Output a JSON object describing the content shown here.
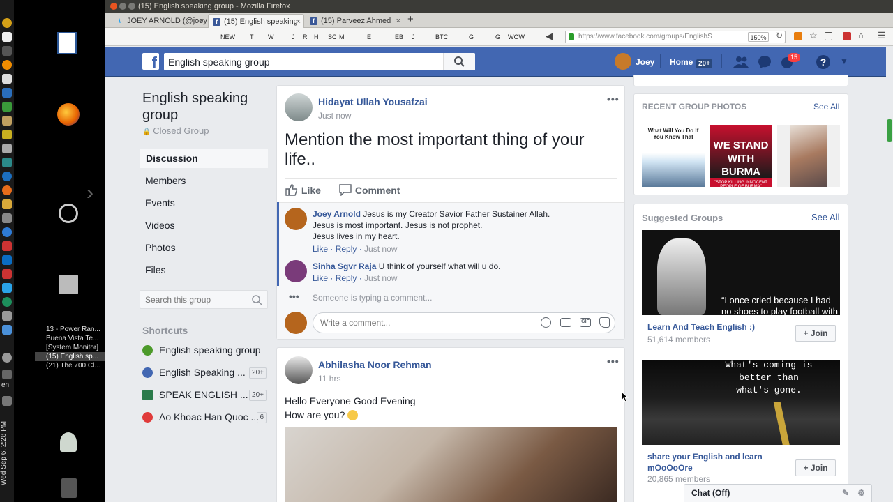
{
  "window": {
    "title": "(15) English speaking group - Mozilla Firefox",
    "tabs": [
      {
        "label": "JOEY ARNOLD (@joey"
      },
      {
        "label": "(15) English speaking"
      },
      {
        "label": "(15) Parveez Ahmed"
      }
    ],
    "new_tab": "+",
    "bookmarks": [
      "NEW",
      "T",
      "W",
      "J",
      "R",
      "H",
      "SC",
      "M",
      "E",
      "EB",
      "J",
      "BTC",
      "G",
      "G",
      "WOW"
    ],
    "url": "https://www.facebook.com/groups/EnglishS",
    "zoom": "150%"
  },
  "desktop": {
    "taskbar_items": [
      "13 - Power Ran...",
      "Buena Vista Te...",
      "[System Monitor]",
      "(15) English sp...",
      "(21) The 700 Cl..."
    ],
    "keyboard": "en",
    "clock": "Wed Sep 6, 2:28 PM"
  },
  "fbheader": {
    "logo": "f",
    "search_value": "English speaking group",
    "user": "Joey",
    "home": "Home",
    "home_count": "20+",
    "notif_count": "15"
  },
  "group": {
    "name": "English speaking group",
    "privacy": "Closed Group",
    "nav": [
      "Discussion",
      "Members",
      "Events",
      "Videos",
      "Photos",
      "Files"
    ],
    "search_placeholder": "Search this group",
    "shortcuts_title": "Shortcuts",
    "shortcuts": [
      {
        "label": "English speaking group",
        "count": ""
      },
      {
        "label": "English Speaking ...",
        "count": "20+"
      },
      {
        "label": "SPEAK ENGLISH ...",
        "count": "20+"
      },
      {
        "label": "Ao Khoac Han Quoc ...",
        "count": "6"
      }
    ]
  },
  "post1": {
    "author": "Hidayat Ullah Yousafzai",
    "time": "Just now",
    "text": "Mention the most important thing of your life..",
    "like": "Like",
    "comment": "Comment",
    "comments": [
      {
        "author": "Joey Arnold",
        "lines": [
          "Jesus is my Creator Savior Father Sustainer Allah.",
          "Jesus is most important. Jesus is not prophet.",
          "Jesus lives in my heart."
        ],
        "like": "Like",
        "reply": "Reply",
        "time": "Just now"
      },
      {
        "author": "Sinha Sgvr Raja",
        "lines": [
          "U think of yourself what will u do."
        ],
        "like": "Like",
        "reply": "Reply",
        "time": "Just now"
      }
    ],
    "typing": "Someone is typing a comment...",
    "write_placeholder": "Write a comment..."
  },
  "post2": {
    "author": "Abhilasha Noor Rehman",
    "time": "11 hrs",
    "line1": "Hello Everyone Good Evening",
    "line2": "How are you?"
  },
  "right": {
    "photos_title": "RECENT GROUP PHOTOS",
    "see_all": "See All",
    "photo1_text": "What Will You Do If You Know That",
    "photo2_big": "WE STAND WITH BURMA",
    "photo2_small": "\"STOP KILLING INNOCENT PEOPLE OF BURMA\"",
    "suggested_title": "Suggested Groups",
    "groups": [
      {
        "name": "Learn And Teach English :)",
        "members": "51,614 members",
        "join": "Join",
        "quote": "“I once cried because I had no shoes to play football with my"
      },
      {
        "name": "share your English and learn mOoOoOre",
        "members": "20,865 members",
        "join": "Join",
        "quote": "What's coming is better than what's gone."
      }
    ]
  },
  "chat": {
    "label": "Chat (Off)"
  },
  "colors": {
    "fb_blue": "#4267b2",
    "link": "#365899",
    "bg": "#e9ebee",
    "badge": "#fa3e3e"
  }
}
